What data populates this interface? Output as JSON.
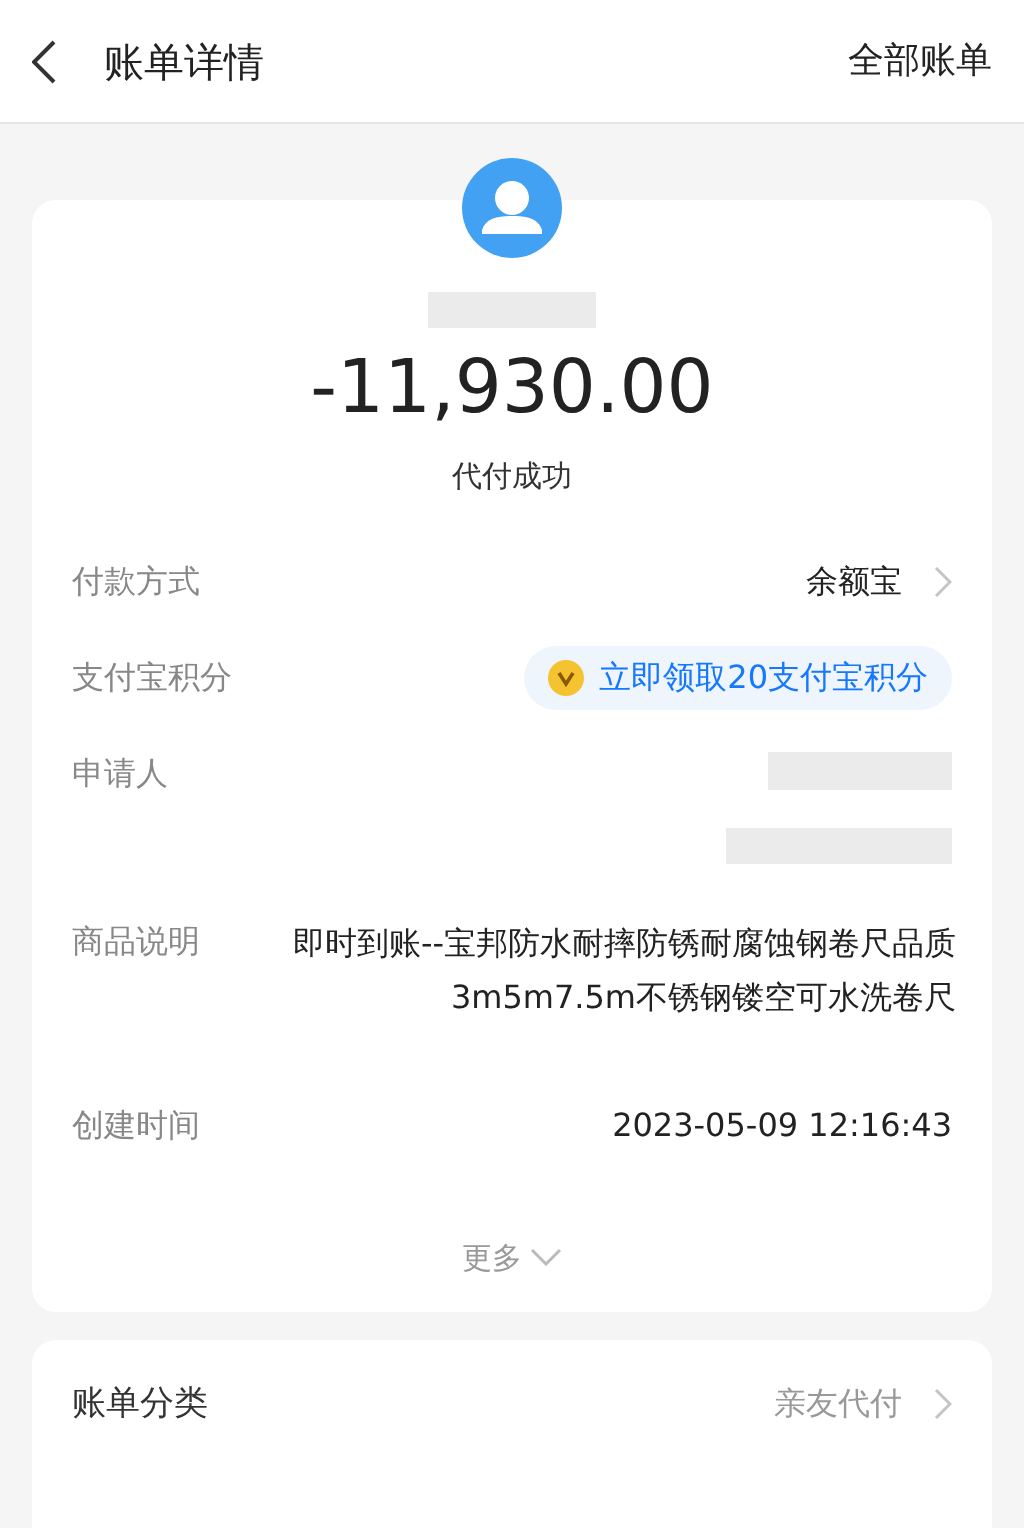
{
  "header": {
    "title": "账单详情",
    "action": "全部账单"
  },
  "summary": {
    "amount": "-11,930.00",
    "status": "代付成功"
  },
  "rows": [
    {
      "kind": "link",
      "label": "付款方式",
      "value": "余额宝"
    },
    {
      "kind": "badge",
      "label": "支付宝积分",
      "value": "立即领取20支付宝积分"
    },
    {
      "kind": "redacted",
      "label": "申请人"
    },
    {
      "kind": "multiline",
      "label": "商品说明",
      "value": "即时到账--宝邦防水耐摔防锈耐腐蚀钢卷尺品质3m5m7.5m不锈钢镂空可水洗卷尺"
    },
    {
      "kind": "text",
      "label": "创建时间",
      "value": "2023-05-09 12:16:43"
    }
  ],
  "more": {
    "label": "更多",
    "expanded": false
  },
  "category": {
    "label": "账单分类",
    "value": "亲友代付"
  }
}
